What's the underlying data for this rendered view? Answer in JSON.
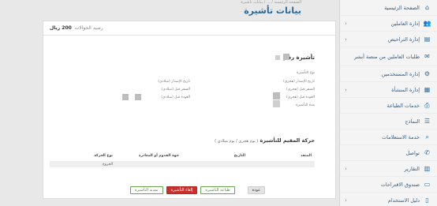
{
  "topbar": {
    "breadcrumb": "الصفحة الرئيسية / ... / بيانات تأشيرة",
    "page_title": "بيانات تأشيرة"
  },
  "sidebar": {
    "items": [
      {
        "label": "الصفحة الرئيسية",
        "icon": "home-icon",
        "chevron": false
      },
      {
        "label": "إدارة العاملين",
        "icon": "users-icon",
        "chevron": true
      },
      {
        "label": "إدارة التراخيص",
        "icon": "license-icon",
        "chevron": true
      },
      {
        "label": "طلبات العاملين من منصة أبشر",
        "icon": "request-icon",
        "chevron": false
      },
      {
        "label": "إدارة المستخدمين",
        "icon": "user-cog-icon",
        "chevron": false
      },
      {
        "label": "إدارة المنشأة",
        "icon": "building-icon",
        "chevron": true
      },
      {
        "label": "خدمات الطباعة",
        "icon": "print-icon",
        "chevron": false
      },
      {
        "label": "النماذج",
        "icon": "forms-icon",
        "chevron": false
      },
      {
        "label": "خدمة الاستعلامات",
        "icon": "search-icon",
        "chevron": false
      },
      {
        "label": "تواصل",
        "icon": "chat-icon",
        "chevron": false
      },
      {
        "label": "التقارير",
        "icon": "report-icon",
        "chevron": true
      },
      {
        "label": "صندوق الاقتراحات",
        "icon": "inbox-icon",
        "chevron": false
      },
      {
        "label": "دليل الاستخدام",
        "icon": "book-icon",
        "chevron": true
      }
    ]
  },
  "card": {
    "balance_label": "رصيد الحوالات",
    "balance_value": "200 ريال"
  },
  "visa": {
    "title": "تأشيرة رقم",
    "right_labels": [
      "نوع التأشيرة",
      "تاريخ الإصدار (هجري)",
      "السفر قبل (هجري)",
      "العودة قبل (هجري)",
      "مدة التأشيرة"
    ],
    "left_labels": [
      "تاريخ الإصدار (ميلادي)",
      "السفر قبل (ميلادي)",
      "العودة قبل (ميلادي)"
    ]
  },
  "movement": {
    "title": "حركة المقيم للتأشيرة",
    "subtitle": "( يوم هجري / يوم ميلادي )",
    "columns": [
      "المنفذ",
      "التاريخ",
      "جهة القدوم أو المغادرة",
      "نوع الحركة"
    ],
    "rows": [
      {
        "port": "",
        "date": "",
        "direction": "",
        "type": "الخروج"
      }
    ]
  },
  "buttons": {
    "back": "عودة",
    "print": "طباعة التأشيرة",
    "cancel": "إلغاء التأشيرة",
    "extend": "تمديد التأشيرة"
  },
  "colors": {
    "accent": "#2e6a9a",
    "danger": "#c9302c",
    "success": "#6aa84f"
  }
}
